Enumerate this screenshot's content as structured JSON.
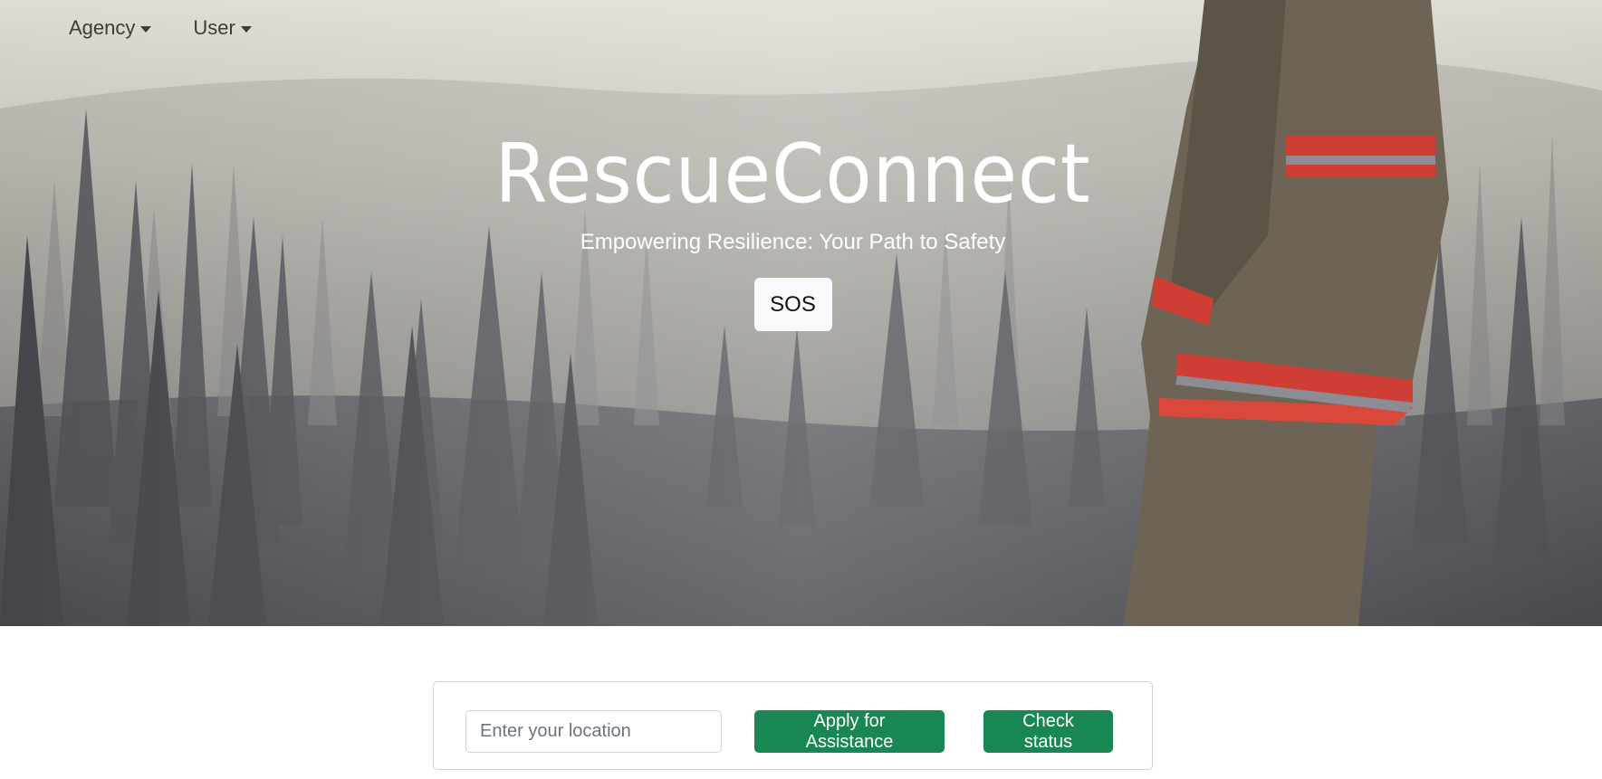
{
  "nav": {
    "items": [
      {
        "label": "Agency"
      },
      {
        "label": "User"
      }
    ]
  },
  "hero": {
    "title": "RescueConnect",
    "subtitle": "Empowering Resilience: Your Path to Safety",
    "sos_label": "SOS"
  },
  "assistance": {
    "location_placeholder": "Enter your location",
    "apply_label": "Apply for Assistance",
    "status_label": "Check status"
  },
  "colors": {
    "accent_green": "#198754",
    "light_button": "#f8f9fa"
  }
}
